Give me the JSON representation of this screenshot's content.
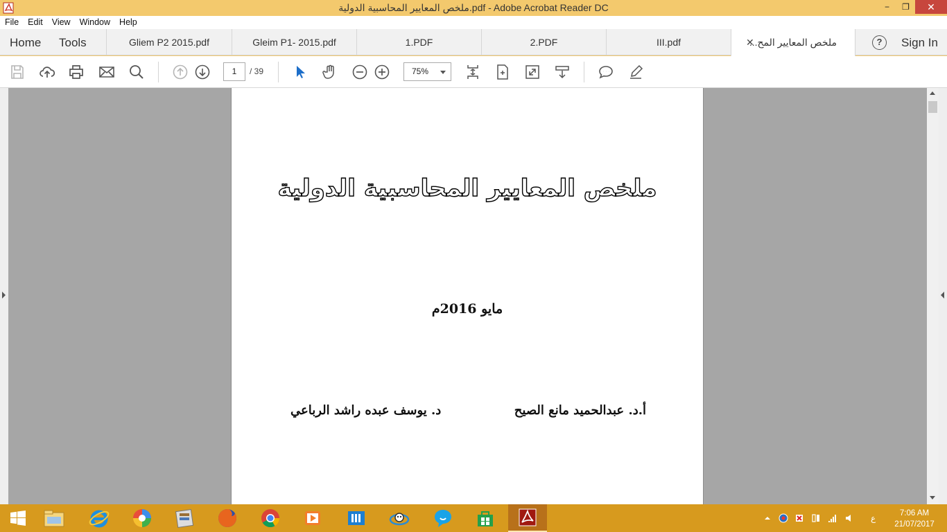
{
  "window": {
    "title": "ملخص المعايير المحاسبية الدولية.pdf - Adobe Acrobat Reader DC",
    "minimize_glyph": "−",
    "restore_glyph": "❐",
    "close_glyph": "✕"
  },
  "menu": [
    "File",
    "Edit",
    "View",
    "Window",
    "Help"
  ],
  "tabs": {
    "home": "Home",
    "tools": "Tools",
    "documents": [
      {
        "label": "Gliem P2 2015.pdf"
      },
      {
        "label": "Gleim P1- 2015.pdf"
      },
      {
        "label": "1.PDF"
      },
      {
        "label": "2.PDF"
      },
      {
        "label": "III.pdf"
      },
      {
        "label": "ملخص المعايير المح...",
        "active": true
      }
    ],
    "close_glyph": "✕",
    "help_glyph": "?",
    "sign_in": "Sign In"
  },
  "toolbar": {
    "current_page": "1",
    "total_pages": "/  39",
    "zoom": "75%",
    "icons": [
      "save-icon",
      "upload-icon",
      "print-icon",
      "email-icon",
      "search-icon",
      "prev-page-icon",
      "next-page-icon",
      "select-cursor-icon",
      "hand-icon",
      "zoom-out-icon",
      "zoom-in-icon",
      "fit-page-icon",
      "fit-width-icon",
      "full-screen-icon",
      "scroll-mode-icon",
      "comment-icon",
      "highlight-icon"
    ]
  },
  "document": {
    "title": "ملخص المعايير المحاسبية الدولية",
    "date": "مايو 2016م",
    "author1": "أ.د. عبدالحميد مانع الصيح",
    "author2": "د. يوسف عبده راشد الرباعي"
  },
  "taskbar": {
    "apps": [
      "start-button",
      "file-explorer-icon",
      "internet-explorer-icon",
      "picasa-icon",
      "archive-icon",
      "firefox-icon",
      "chrome-icon",
      "media-player-icon",
      "store-books-icon",
      "messenger-icon",
      "chat-icon",
      "store-icon",
      "acrobat-icon"
    ],
    "language": "ع",
    "time": "7:06 AM",
    "date": "21/07/2017"
  },
  "colors": {
    "accent_window": "#f3c96d",
    "taskbar": "#d79a1e",
    "close_button": "#c7463d",
    "doc_bg": "#a6a6a6"
  }
}
